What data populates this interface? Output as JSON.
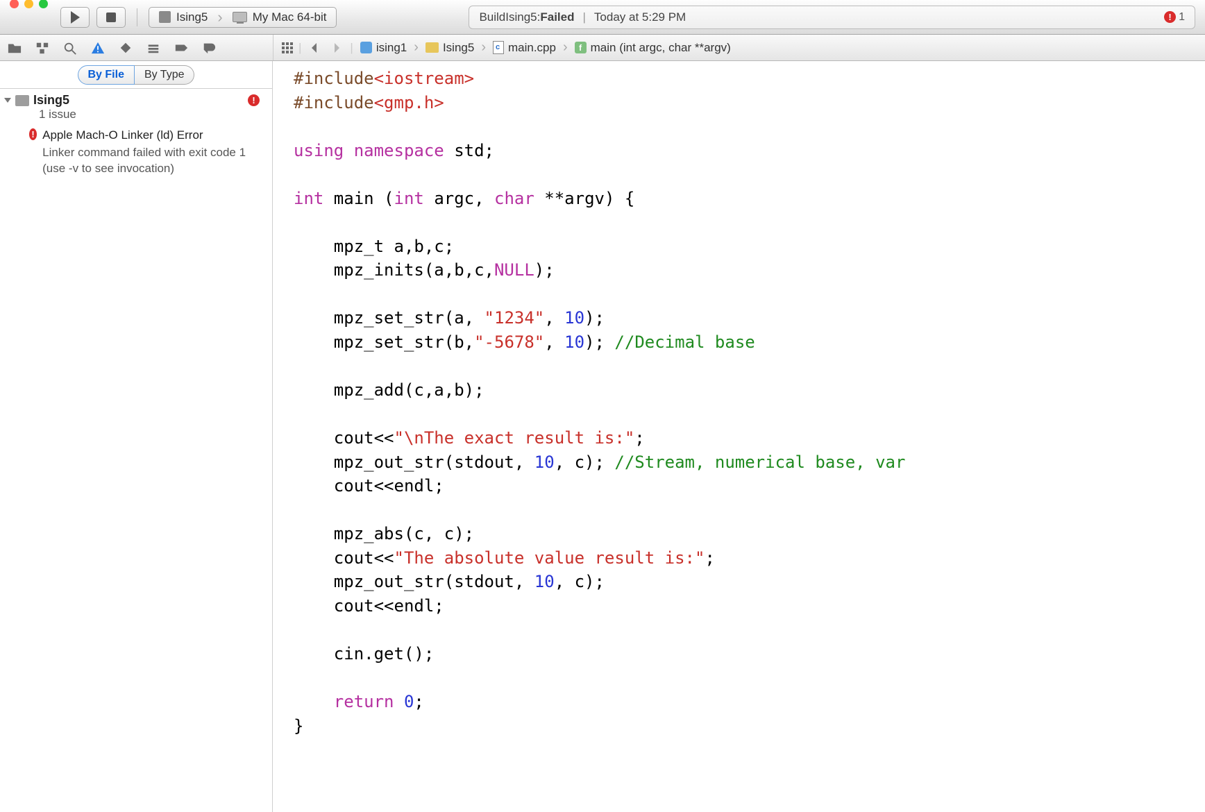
{
  "toolbar": {
    "scheme_target": "Ising5",
    "scheme_device": "My Mac 64-bit"
  },
  "status": {
    "prefix": "Build ",
    "project": "Ising5",
    "colon": ": ",
    "result": "Failed",
    "timestamp": "Today at 5:29 PM",
    "error_count": "1"
  },
  "filter": {
    "by_file": "By File",
    "by_type": "By Type"
  },
  "sidebar": {
    "project": "Ising5",
    "issue_count": "1 issue",
    "issues": [
      {
        "title": "Apple Mach-O Linker (ld) Error",
        "detail": "Linker command failed with exit code 1 (use -v to see invocation)"
      }
    ]
  },
  "breadcrumb": {
    "items": [
      {
        "label": "ising1",
        "kind": "project"
      },
      {
        "label": "Ising5",
        "kind": "folder"
      },
      {
        "label": "main.cpp",
        "kind": "file"
      },
      {
        "label": "main (int argc, char **argv)",
        "kind": "function"
      }
    ]
  },
  "code": {
    "lines": [
      {
        "t": "pp",
        "a": "#include",
        "b": "<iostream>"
      },
      {
        "t": "pp",
        "a": "#include",
        "b": "<gmp.h>"
      },
      {
        "t": "blank"
      },
      {
        "t": "using",
        "a": "using",
        "b": "namespace",
        "c": " std;"
      },
      {
        "t": "blank"
      },
      {
        "t": "sig",
        "a": "int",
        "b": " main (",
        "c": "int",
        "d": " argc, ",
        "e": "char",
        "f": " **argv) {"
      },
      {
        "t": "blank"
      },
      {
        "t": "plain",
        "indent": 1,
        "text": "mpz_t a,b,c;"
      },
      {
        "t": "inits",
        "indent": 1,
        "a": "mpz_inits(a,b,c,",
        "b": "NULL",
        "c": ");"
      },
      {
        "t": "blank"
      },
      {
        "t": "setstr",
        "indent": 1,
        "a": "mpz_set_str(a, ",
        "s": "\"1234\"",
        "b": ", ",
        "n": "10",
        "c": ");"
      },
      {
        "t": "setstrc",
        "indent": 1,
        "a": "mpz_set_str(b,",
        "s": "\"-5678\"",
        "b": ", ",
        "n": "10",
        "c": "); ",
        "com": "//Decimal base"
      },
      {
        "t": "blank"
      },
      {
        "t": "plain",
        "indent": 1,
        "text": "mpz_add(c,a,b);"
      },
      {
        "t": "blank"
      },
      {
        "t": "cout",
        "indent": 1,
        "a": "cout<<",
        "s": "\"\\nThe exact result is:\"",
        "b": ";"
      },
      {
        "t": "outc",
        "indent": 1,
        "a": "mpz_out_str(stdout, ",
        "n": "10",
        "b": ", c); ",
        "com": "//Stream, numerical base, var"
      },
      {
        "t": "plain",
        "indent": 1,
        "text": "cout<<endl;"
      },
      {
        "t": "blank"
      },
      {
        "t": "plain",
        "indent": 1,
        "text": "mpz_abs(c, c);"
      },
      {
        "t": "cout",
        "indent": 1,
        "a": "cout<<",
        "s": "\"The absolute value result is:\"",
        "b": ";"
      },
      {
        "t": "out",
        "indent": 1,
        "a": "mpz_out_str(stdout, ",
        "n": "10",
        "b": ", c);"
      },
      {
        "t": "plain",
        "indent": 1,
        "text": "cout<<endl;"
      },
      {
        "t": "blank"
      },
      {
        "t": "plain",
        "indent": 1,
        "text": "cin.get();"
      },
      {
        "t": "blank"
      },
      {
        "t": "ret",
        "indent": 1,
        "a": "return",
        "n": "0",
        "b": ";"
      },
      {
        "t": "plain",
        "indent": 0,
        "text": "}"
      }
    ]
  }
}
